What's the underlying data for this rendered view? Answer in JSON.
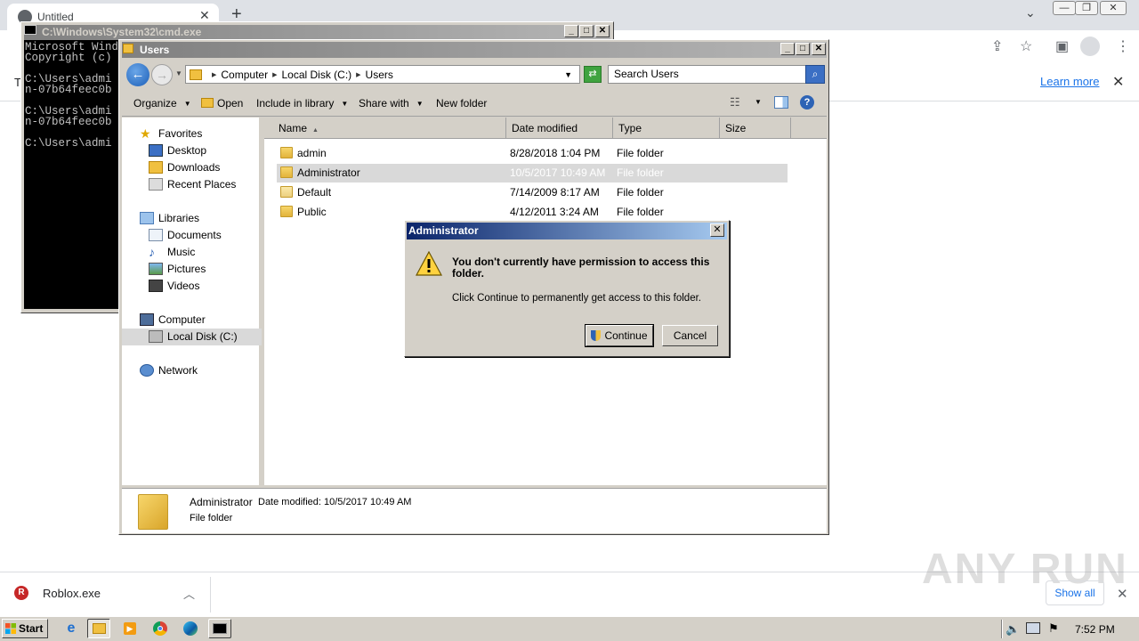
{
  "browser": {
    "tab_title": "Untitled",
    "new_tab_symbol": "+",
    "infobar_text": "T",
    "learn_more": "Learn more",
    "download_name": "Roblox.exe",
    "show_all": "Show all",
    "watermark": "ANY RUN"
  },
  "cmd": {
    "title": "C:\\Windows\\System32\\cmd.exe",
    "console_text": "Microsoft Wind\nCopyright (c)\n\nC:\\Users\\admi\nn-07b64feec0b\n\nC:\\Users\\admi\nn-07b64feec0b\n\nC:\\Users\\admi"
  },
  "explorer": {
    "title": "Users",
    "breadcrumbs": [
      "Computer",
      "Local Disk (C:)",
      "Users"
    ],
    "search_placeholder": "Search Users",
    "toolbar": {
      "organize": "Organize",
      "open": "Open",
      "include_in_library": "Include in library",
      "share_with": "Share with",
      "new_folder": "New folder"
    },
    "nav": {
      "favorites": "Favorites",
      "desktop": "Desktop",
      "downloads": "Downloads",
      "recent_places": "Recent Places",
      "libraries": "Libraries",
      "documents": "Documents",
      "music": "Music",
      "pictures": "Pictures",
      "videos": "Videos",
      "computer": "Computer",
      "local_disk": "Local Disk (C:)",
      "network": "Network"
    },
    "columns": {
      "name": "Name",
      "date_modified": "Date modified",
      "type": "Type",
      "size": "Size"
    },
    "files": [
      {
        "name": "admin",
        "date": "8/28/2018 1:04 PM",
        "type": "File folder"
      },
      {
        "name": "Administrator",
        "date": "10/5/2017 10:49 AM",
        "type": "File folder"
      },
      {
        "name": "Default",
        "date": "7/14/2009 8:17 AM",
        "type": "File folder"
      },
      {
        "name": "Public",
        "date": "4/12/2011 3:24 AM",
        "type": "File folder"
      }
    ],
    "details": {
      "name": "Administrator",
      "date_label": "Date modified: 10/5/2017 10:49 AM",
      "type": "File folder"
    }
  },
  "dialog": {
    "title": "Administrator",
    "heading": "You don't currently have permission to access this folder.",
    "body": "Click Continue to permanently get access to this folder.",
    "continue": "Continue",
    "cancel": "Cancel"
  },
  "taskbar": {
    "start": "Start",
    "clock": "7:52 PM"
  }
}
